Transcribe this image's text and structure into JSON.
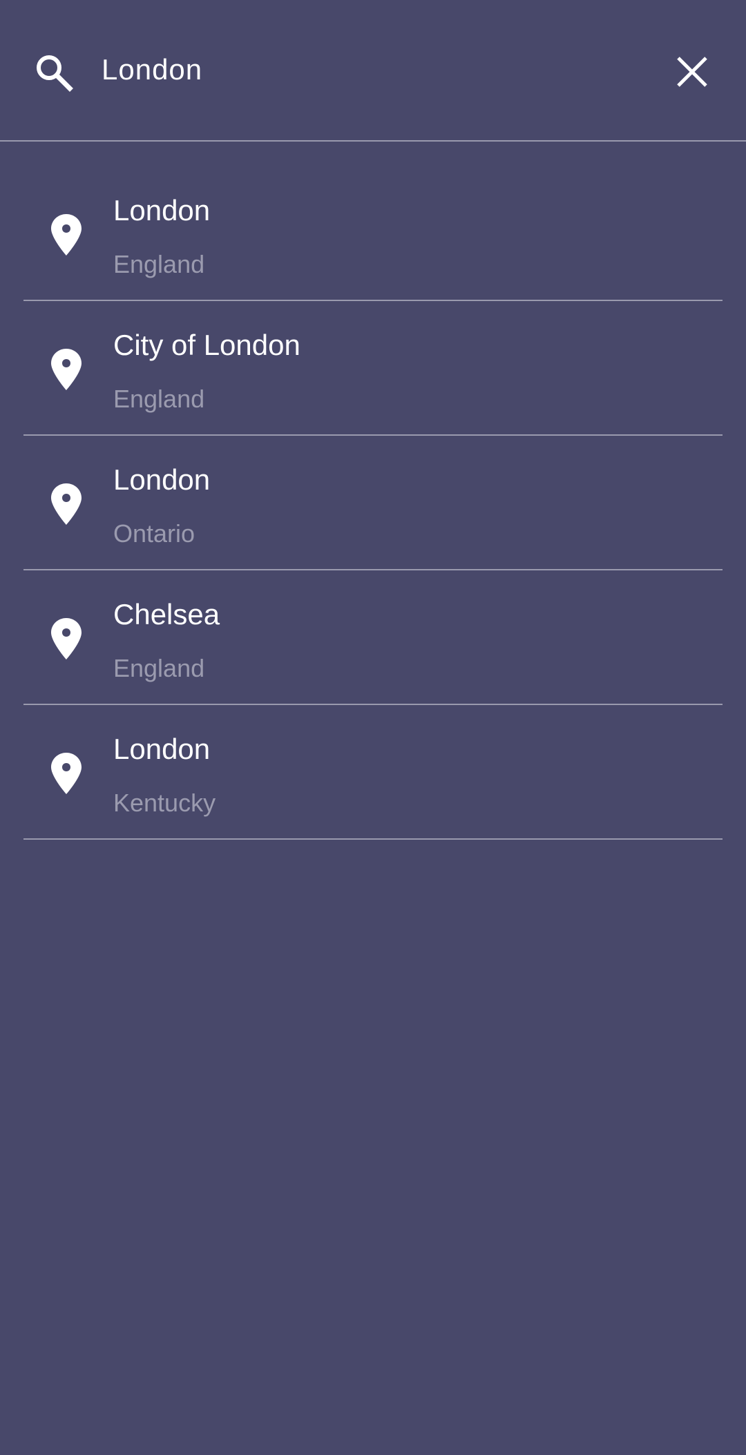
{
  "search": {
    "value": "London",
    "icon": "search-icon",
    "clear_icon": "close-icon"
  },
  "results": [
    {
      "title": "London",
      "subtitle": "England",
      "icon": "map-pin-icon"
    },
    {
      "title": "City of London",
      "subtitle": "England",
      "icon": "map-pin-icon"
    },
    {
      "title": "London",
      "subtitle": "Ontario",
      "icon": "map-pin-icon"
    },
    {
      "title": "Chelsea",
      "subtitle": "England",
      "icon": "map-pin-icon"
    },
    {
      "title": "London",
      "subtitle": "Kentucky",
      "icon": "map-pin-icon"
    }
  ],
  "colors": {
    "background": "#48486a",
    "divider": "#9a9aae",
    "title_text": "#ffffff",
    "subtitle_text": "#9b9baf"
  }
}
